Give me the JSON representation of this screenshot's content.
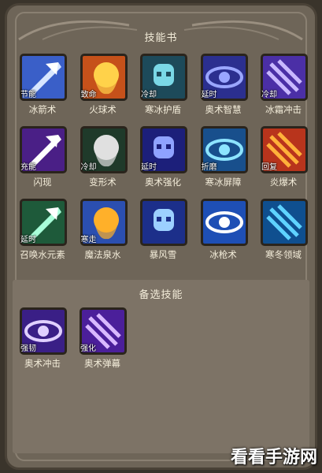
{
  "panel": {
    "title": "技能书"
  },
  "skills": [
    {
      "name": "冰箭术",
      "tag": "节能",
      "icon": "ice-arrow-icon",
      "colors": [
        "#3a5fc8",
        "#d8e6ff"
      ]
    },
    {
      "name": "火球术",
      "tag": "致命",
      "icon": "fireball-icon",
      "colors": [
        "#c6511a",
        "#ffd24a"
      ]
    },
    {
      "name": "寒冰护盾",
      "tag": "冷却",
      "icon": "ice-shield-skull-icon",
      "colors": [
        "#1d4a5a",
        "#7ad8e6"
      ]
    },
    {
      "name": "奥术智慧",
      "tag": "延时",
      "icon": "arcane-eye-icon",
      "colors": [
        "#2b2f8f",
        "#9aa6ff"
      ]
    },
    {
      "name": "冰霜冲击",
      "tag": "冷却",
      "icon": "frost-shock-icon",
      "colors": [
        "#4b2fa6",
        "#c9b8ff"
      ]
    },
    {
      "name": "闪现",
      "tag": "充能",
      "icon": "blink-icon",
      "colors": [
        "#4a1f86",
        "#ffffff"
      ]
    },
    {
      "name": "变形术",
      "tag": "冷却",
      "icon": "polymorph-icon",
      "colors": [
        "#1f3a2a",
        "#e0e0e0"
      ]
    },
    {
      "name": "奥术强化",
      "tag": "延时",
      "icon": "arcane-power-icon",
      "colors": [
        "#1c1f7a",
        "#8fa2ff"
      ]
    },
    {
      "name": "寒冰屏障",
      "tag": "折磨",
      "icon": "ice-block-icon",
      "colors": [
        "#184f8c",
        "#8de4ff"
      ]
    },
    {
      "name": "炎爆术",
      "tag": "回复",
      "icon": "pyroblast-icon",
      "colors": [
        "#b8341c",
        "#ffb13a"
      ]
    },
    {
      "name": "召唤水元素",
      "tag": "延时",
      "icon": "water-elemental-icon",
      "colors": [
        "#1e5a3a",
        "#a8ffd9"
      ]
    },
    {
      "name": "魔法泉水",
      "tag": "寒走",
      "icon": "magic-spring-icon",
      "colors": [
        "#2b4fb0",
        "#ffb02a"
      ]
    },
    {
      "name": "暴风雪",
      "tag": "",
      "icon": "blizzard-icon",
      "colors": [
        "#1c2f8a",
        "#9cd0ff"
      ]
    },
    {
      "name": "冰枪术",
      "tag": "",
      "icon": "ice-lance-icon",
      "colors": [
        "#1e4fb5",
        "#ffffff"
      ]
    },
    {
      "name": "寒冬领域",
      "tag": "",
      "icon": "winter-domain-icon",
      "colors": [
        "#0f4f8f",
        "#5fd3ff"
      ]
    }
  ],
  "reserve": {
    "title": "备选技能",
    "skills": [
      {
        "name": "奥术冲击",
        "tag": "强韧",
        "icon": "arcane-blast-icon",
        "colors": [
          "#3a1f86",
          "#e0d0ff"
        ]
      },
      {
        "name": "奥术弹幕",
        "tag": "强化",
        "icon": "arcane-barrage-icon",
        "colors": [
          "#4b1f9a",
          "#d9b8ff"
        ]
      }
    ]
  },
  "watermark": "看看手游网"
}
